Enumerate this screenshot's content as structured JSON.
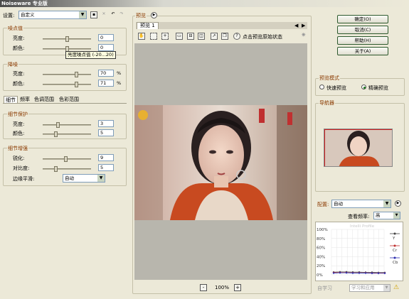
{
  "window": {
    "title": "Noiseware 专业版"
  },
  "settings": {
    "label": "设置:",
    "preset": "自定义"
  },
  "noise_levels": {
    "title": "噪点值",
    "brightness_label": "亮度:",
    "brightness_value": "0",
    "color_label": "颜色:",
    "color_value": "0",
    "tooltip": "亮度噪点值 (-20...20)"
  },
  "noise_reduction": {
    "title": "降噪",
    "brightness_label": "亮度:",
    "brightness_value": "70",
    "color_label": "颜色:",
    "color_value": "71",
    "unit": "%",
    "brightness_level": 70,
    "color_level": 71
  },
  "tabs": [
    "细节",
    "频率",
    "色调范围",
    "色彩范围"
  ],
  "detail_protection": {
    "title": "细节保护",
    "brightness_label": "亮度:",
    "brightness_value": "3",
    "color_label": "颜色:",
    "color_value": "5"
  },
  "detail_enhancement": {
    "title": "细节增强",
    "sharpen_label": "锐化:",
    "sharpen_value": "9",
    "contrast_label": "对比度:",
    "contrast_value": "5",
    "edge_label": "边缘平滑:",
    "edge_value": "自动"
  },
  "preview": {
    "title": "预览",
    "tab": "预览 1",
    "hint": "点击预览原始状态",
    "zoom": "100%",
    "zoom_out": "-",
    "zoom_in": "+"
  },
  "buttons": {
    "ok": "确定(O)",
    "cancel": "取消(C)",
    "help": "帮助(H)",
    "about": "关于(A)"
  },
  "preview_mode": {
    "title": "预览模式",
    "fast": "快速预览",
    "accurate": "精确预览",
    "selected": "accurate"
  },
  "navigator": {
    "title": "导航器"
  },
  "profile": {
    "label": "配置:",
    "value": "自动",
    "freq_label": "查看频率:",
    "freq_value": "高",
    "watermark": "Intelli Profile",
    "y_ticks": [
      "100%",
      "80%",
      "60%",
      "40%",
      "20%",
      "0%"
    ],
    "legend": [
      "Y",
      "Cr",
      "Cb"
    ],
    "learn": "自学习",
    "learn_apply": "学习和应用"
  },
  "colors": {
    "group_title": "#8a3a00",
    "line_y": "#444444",
    "line_cr": "#c03030",
    "line_cb": "#3030b0",
    "nav_frame": "#d02020"
  }
}
